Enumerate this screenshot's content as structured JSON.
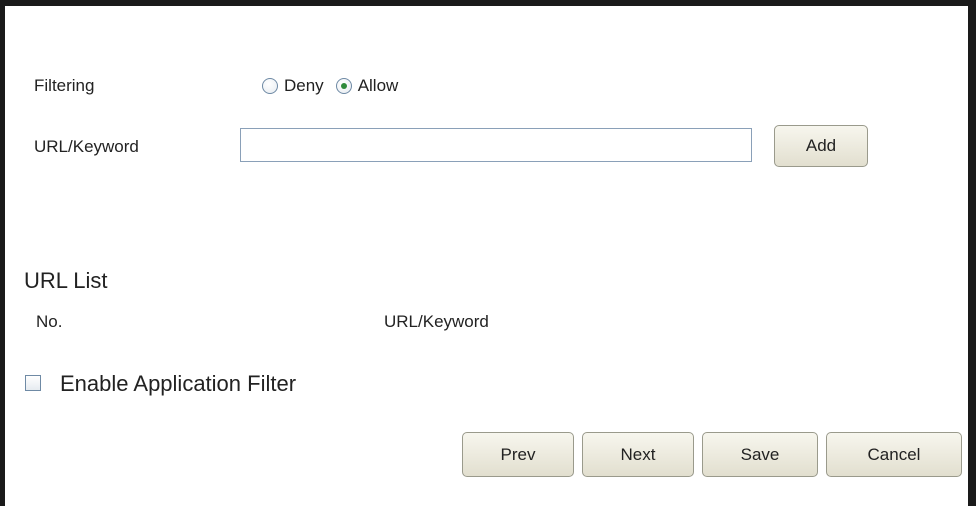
{
  "filtering": {
    "label": "Filtering",
    "options": [
      {
        "label": "Deny",
        "checked": false
      },
      {
        "label": "Allow",
        "checked": true
      }
    ]
  },
  "url_field": {
    "label": "URL/Keyword",
    "value": "",
    "placeholder": ""
  },
  "add_button": {
    "label": "Add"
  },
  "url_list": {
    "heading": "URL List",
    "columns": [
      "No.",
      "URL/Keyword"
    ]
  },
  "app_filter": {
    "label": "Enable Application Filter",
    "checked": false
  },
  "footer": {
    "prev_label": "Prev",
    "next_label": "Next",
    "save_label": "Save",
    "cancel_label": "Cancel"
  }
}
